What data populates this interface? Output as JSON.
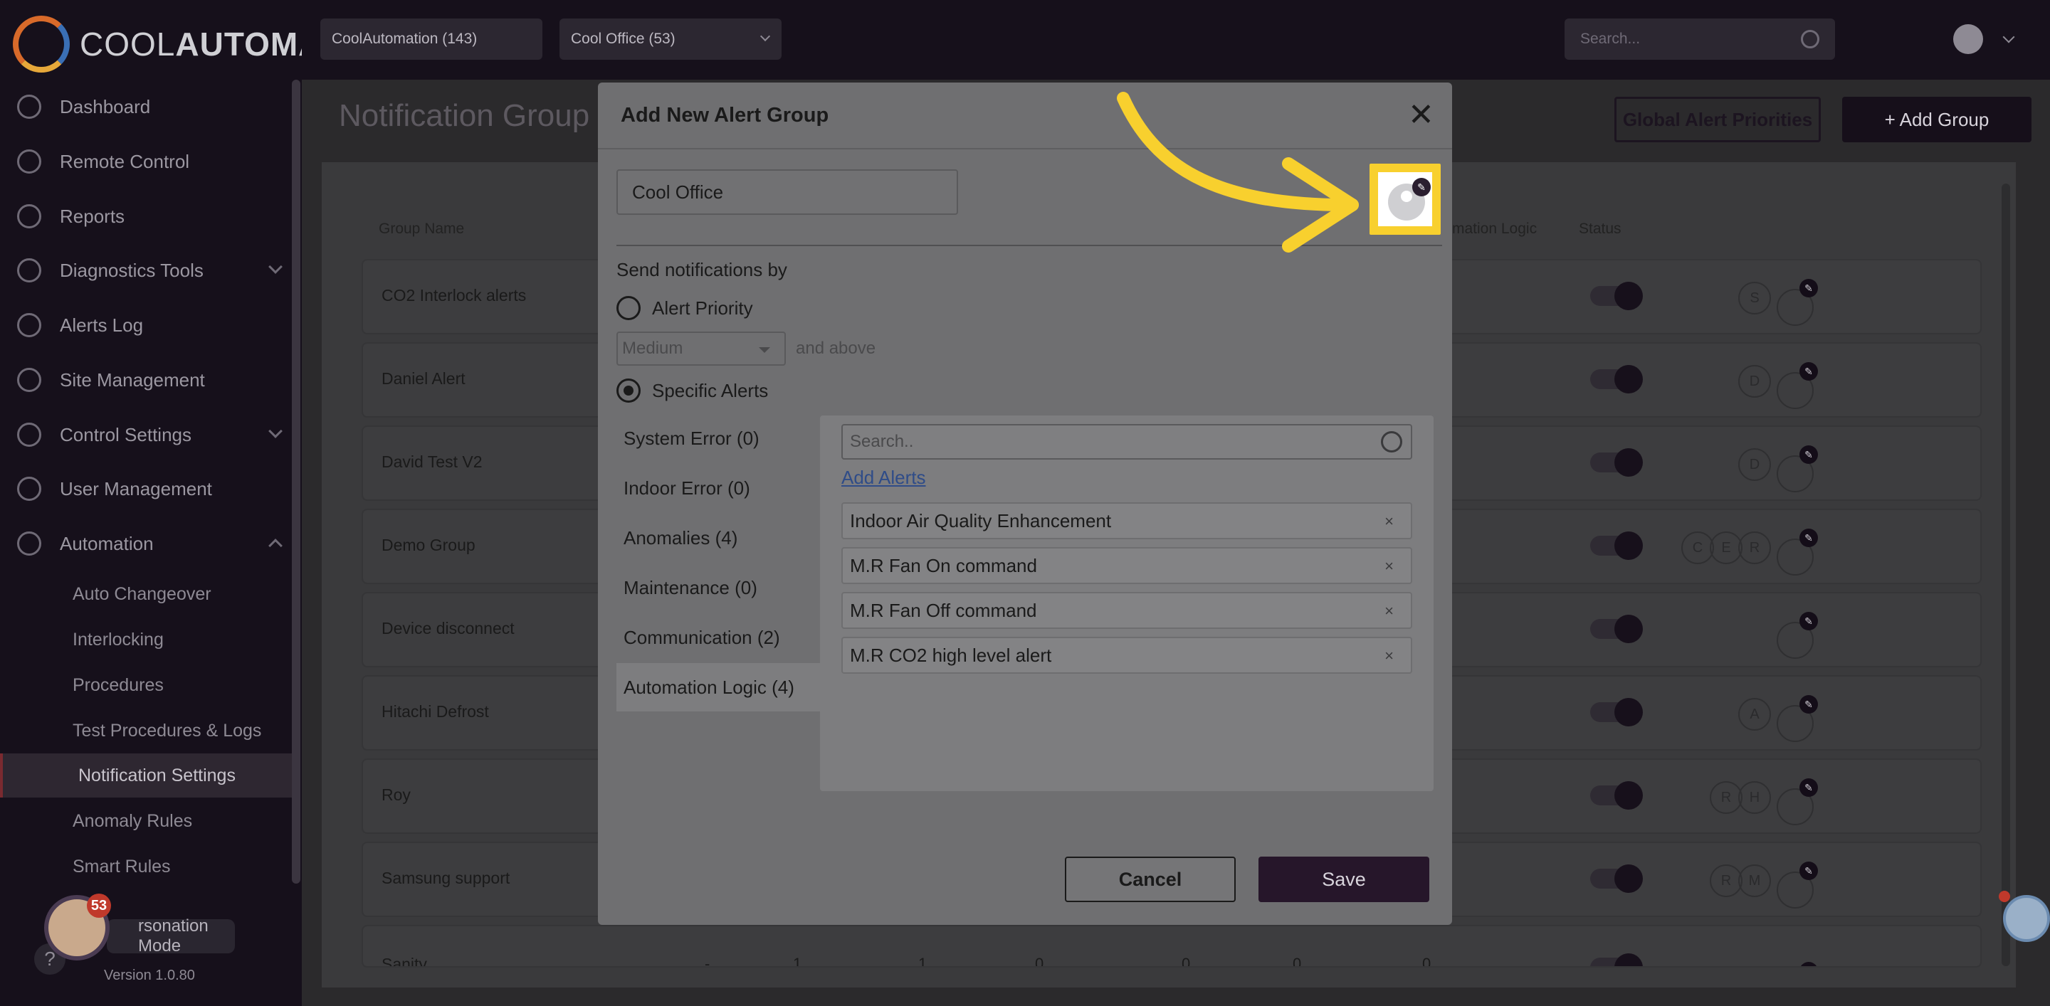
{
  "app": {
    "logo_text_light": "COOL",
    "logo_text_bold": "AUTOMATION"
  },
  "topbar": {
    "customer_select": "CoolAutomation (143)",
    "site_select": "Cool Office (53)",
    "search_placeholder": "Search..."
  },
  "sidebar": {
    "items": [
      {
        "label": "Dashboard",
        "icon": "dashboard-icon"
      },
      {
        "label": "Remote Control",
        "icon": "remote-icon"
      },
      {
        "label": "Reports",
        "icon": "reports-icon"
      },
      {
        "label": "Diagnostics Tools",
        "icon": "diagnostics-icon"
      },
      {
        "label": "Alerts Log",
        "icon": "bell-icon"
      },
      {
        "label": "Site Management",
        "icon": "building-icon"
      },
      {
        "label": "Control Settings",
        "icon": "gear-icon"
      },
      {
        "label": "User Management",
        "icon": "user-icon"
      },
      {
        "label": "Automation",
        "icon": "automation-icon"
      }
    ],
    "sub_items": [
      {
        "label": "Auto Changeover"
      },
      {
        "label": "Interlocking"
      },
      {
        "label": "Procedures"
      },
      {
        "label": "Test Procedures & Logs"
      },
      {
        "label": "Notification Settings"
      },
      {
        "label": "Anomaly Rules"
      },
      {
        "label": "Smart Rules"
      }
    ],
    "helper_badge": "53",
    "impersonation": "rsonation Mode",
    "help": "?",
    "version": "Version 1.0.80"
  },
  "main": {
    "page_title": "Notification Group S",
    "global_priorities_button": "Global Alert Priorities",
    "add_group_button": "+ Add Group",
    "headers": {
      "group_name": "Group Name",
      "logic": "mation Logic",
      "status": "Status"
    },
    "rows": [
      {
        "name": "CO2 Interlock alerts",
        "avatars": [
          "S"
        ]
      },
      {
        "name": "Daniel Alert",
        "avatars": [
          "D"
        ]
      },
      {
        "name": "David Test V2",
        "avatars": [
          "D"
        ]
      },
      {
        "name": "Demo Group",
        "avatars": [
          "C",
          "E",
          "R"
        ]
      },
      {
        "name": "Device disconnect",
        "avatars": []
      },
      {
        "name": "Hitachi Defrost",
        "avatars": [
          "A"
        ]
      },
      {
        "name": "Roy",
        "avatars": [
          "R",
          "H"
        ]
      },
      {
        "name": "Samsung support",
        "avatars": [
          "R",
          "M"
        ]
      },
      {
        "name": "Sanity",
        "avatars": [
          "S"
        ]
      }
    ],
    "sanity_cells": [
      "-",
      "1",
      "1",
      "0",
      "0",
      "0",
      "0"
    ]
  },
  "modal": {
    "title": "Add New Alert Group",
    "close": "✕",
    "name_value": "Cool Office",
    "send_label": "Send notifications by",
    "radio_priority": "Alert Priority",
    "priority_value": "Medium",
    "and_above": "and above",
    "radio_specific": "Specific Alerts",
    "categories": [
      {
        "label": "System Error (0)"
      },
      {
        "label": "Indoor Error (0)"
      },
      {
        "label": "Anomalies (4)"
      },
      {
        "label": "Maintenance (0)"
      },
      {
        "label": "Communication (2)"
      },
      {
        "label": "Automation Logic (4)"
      }
    ],
    "search_placeholder": "Search..",
    "add_alerts": "Add Alerts",
    "alerts": [
      {
        "label": "Indoor Air Quality Enhancement"
      },
      {
        "label": "M.R Fan On command"
      },
      {
        "label": "M.R Fan Off command"
      },
      {
        "label": "M.R CO2 high level alert"
      }
    ],
    "remove_glyph": "×",
    "cancel": "Cancel",
    "save": "Save"
  },
  "colors": {
    "highlight": "#f8d02e",
    "brand_dark": "#26162a"
  }
}
